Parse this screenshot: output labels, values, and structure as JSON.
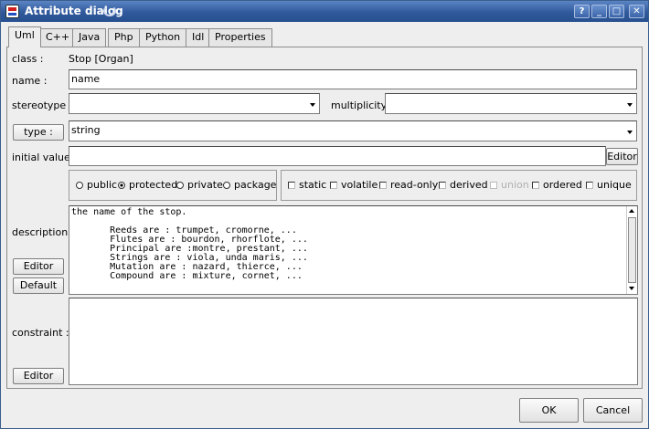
{
  "window": {
    "title": "Attribute dialog"
  },
  "titlebar_buttons": {
    "help": "?",
    "minimize": "_",
    "maximize": "□",
    "close": "✕"
  },
  "tabs": [
    {
      "label": "Uml",
      "active": true
    },
    {
      "label": "C++"
    },
    {
      "label": "Java"
    },
    {
      "label": "Php"
    },
    {
      "label": "Python"
    },
    {
      "label": "Idl"
    },
    {
      "label": "Properties"
    }
  ],
  "form": {
    "class_label": "class :",
    "class_value": "Stop   [Organ]",
    "name_label": "name :",
    "name_value": "name",
    "stereotype_label": "stereotype :",
    "stereotype_value": "",
    "multiplicity_label": "multiplicity :",
    "multiplicity_value": "",
    "type_button": "type :",
    "type_value": "string",
    "initial_value_label": "initial value :",
    "initial_value": "",
    "initial_value_editor": "Editor",
    "visibility": [
      {
        "label": "public",
        "selected": false
      },
      {
        "label": "protected",
        "selected": true
      },
      {
        "label": "private",
        "selected": false
      },
      {
        "label": "package",
        "selected": false
      }
    ],
    "flags": [
      {
        "label": "static",
        "checked": false,
        "enabled": true
      },
      {
        "label": "volatile",
        "checked": false,
        "enabled": true
      },
      {
        "label": "read-only",
        "checked": false,
        "enabled": true
      },
      {
        "label": "derived",
        "checked": false,
        "enabled": true
      },
      {
        "label": "union",
        "checked": false,
        "enabled": false
      },
      {
        "label": "ordered",
        "checked": false,
        "enabled": true
      },
      {
        "label": "unique",
        "checked": false,
        "enabled": true
      }
    ],
    "description_label": "description :",
    "description_lines": [
      "the name of the stop.",
      "",
      "       Reeds are : trumpet, cromorne, ...",
      "       Flutes are : bourdon, rhorflote, ...",
      "       Principal are :montre, prestant, ...",
      "       Strings are : viola, unda maris, ...",
      "       Mutation are : nazard, thierce, ...",
      "       Compound are : mixture, cornet, ..."
    ],
    "description_editor": "Editor",
    "description_default": "Default",
    "constraint_label": "constraint :",
    "constraint_value": "",
    "constraint_editor": "Editor"
  },
  "footer": {
    "ok": "OK",
    "cancel": "Cancel"
  }
}
